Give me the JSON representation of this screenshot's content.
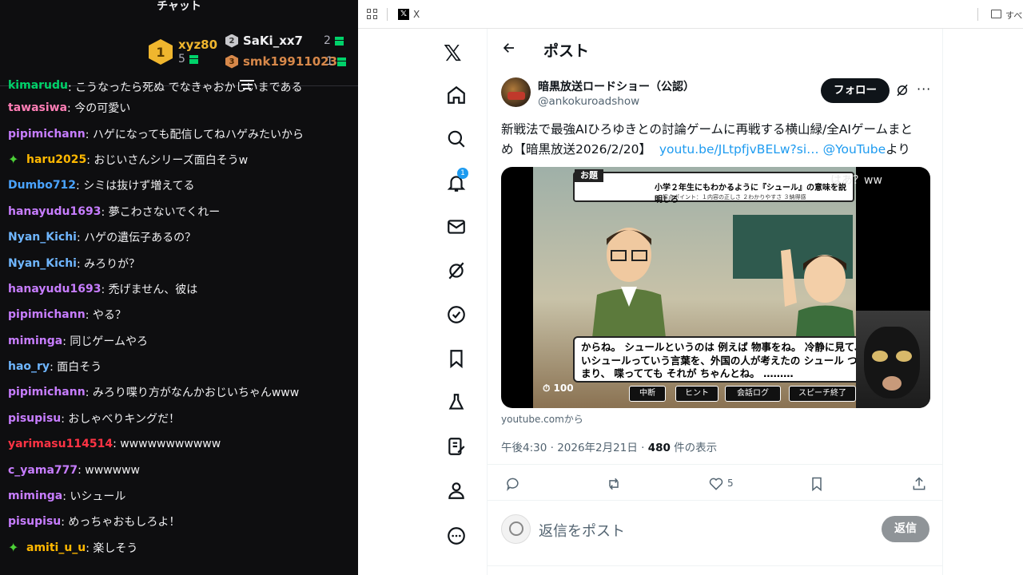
{
  "chat": {
    "title": "チャット",
    "leaderboard": {
      "first": {
        "rank": "1",
        "name": "xyz80",
        "count": "5"
      },
      "second": {
        "rank": "2",
        "name": "SaKi_xx7",
        "count": "2"
      },
      "third": {
        "rank": "3",
        "name": "smk19911023",
        "count": "1"
      }
    },
    "messages": [
      {
        "user": "kimarudu",
        "text": ": こうなったら死ぬ でなきゃおかしいまである",
        "color": "#00d26a"
      },
      {
        "user": "tawasiwa",
        "text": ": 今の可愛い",
        "color": "#ff7eb6"
      },
      {
        "user": "pipimichann",
        "text": ": ハゲになっても配信してねハゲみたいから",
        "color": "#c77dff"
      },
      {
        "user": "haru2025",
        "text": ": おじいさんシリーズ面白そうw",
        "color": "#ffb800",
        "star": true
      },
      {
        "user": "Dumbo712",
        "text": ": シミは抜けず増えてる",
        "color": "#4aa3ff"
      },
      {
        "user": "hanayudu1693",
        "text": ": 夢こわさないでくれー",
        "color": "#c77dff"
      },
      {
        "user": "Nyan_Kichi",
        "text": ": ハゲの遺伝子あるの？",
        "color": "#6fb6ff"
      },
      {
        "user": "Nyan_Kichi",
        "text": ": みろりが？",
        "color": "#6fb6ff"
      },
      {
        "user": "hanayudu1693",
        "text": ": 禿げません、彼は",
        "color": "#c77dff"
      },
      {
        "user": "pipimichann",
        "text": ": やる？",
        "color": "#c77dff"
      },
      {
        "user": "miminga",
        "text": ": 同じゲームやろ",
        "color": "#c77dff"
      },
      {
        "user": "hao_ry",
        "text": ": 面白そう",
        "color": "#6fb6ff"
      },
      {
        "user": "pipimichann",
        "text": ": みろり喋り方がなんかおじいちゃんwww",
        "color": "#c77dff"
      },
      {
        "user": "pisupisu",
        "text": ": おしゃべりキングだ！",
        "color": "#c77dff"
      },
      {
        "user": "yarimasu114514",
        "text": ": wwwwwwwwwww",
        "color": "#ff3344"
      },
      {
        "user": "c_yama777",
        "text": ": wwwwww",
        "color": "#c77dff"
      },
      {
        "user": "miminga",
        "text": ": いシュール",
        "color": "#c77dff"
      },
      {
        "user": "pisupisu",
        "text": ": めっちゃおもしろよ！",
        "color": "#c77dff"
      },
      {
        "user": "amiti_u_u",
        "text": ": 楽しそう",
        "color": "#ffb800",
        "star": true
      }
    ]
  },
  "browser": {
    "tab_title": "X",
    "bookmarks_label": "すべ"
  },
  "x": {
    "page_title": "ポスト",
    "notif_count": "1",
    "account_name": "暗黒放送ロードショー（公認）",
    "account_handle": "@ankokuroadshow",
    "follow_label": "フォロー",
    "post_text_1": "新戦法で最強AIひろゆきとの討論ゲームに再戦する横山緑/全AIゲームまと",
    "post_text_2": "め【暗黒放送2026/2/20】",
    "post_link": "youtu.be/JLtpfjvBELw?si…",
    "post_link2": "@YouTube",
    "post_suffix": "より",
    "media": {
      "question_tag": "お題",
      "question": "小学２年生にもわかるように『シュール』の意味を説明しろ",
      "criteria": "採点ポイント：１内容の正しさ ２わかりやすさ ３納得感",
      "subtitle": "からね。 シュールというのは 例えば 物事をね。 冷静に見て、いシュールっていう言葉を、外国の人が考えたの シュール つまり、 喋ってても それが ちゃんとね。 ………",
      "timer": "100",
      "btn_pause": "中断",
      "btn_hint": "ヒント",
      "btn_log": "会話ログ",
      "btn_speech": "スピーチ終了",
      "overlay": "はあ？ww"
    },
    "media_source": "youtube.comから",
    "timestamp": "午後4:30 · 2026年2月21日 · ",
    "views": "480",
    "views_label": " 件の表示",
    "likes": "5",
    "reply_placeholder": "返信をポスト",
    "reply_button": "返信"
  }
}
